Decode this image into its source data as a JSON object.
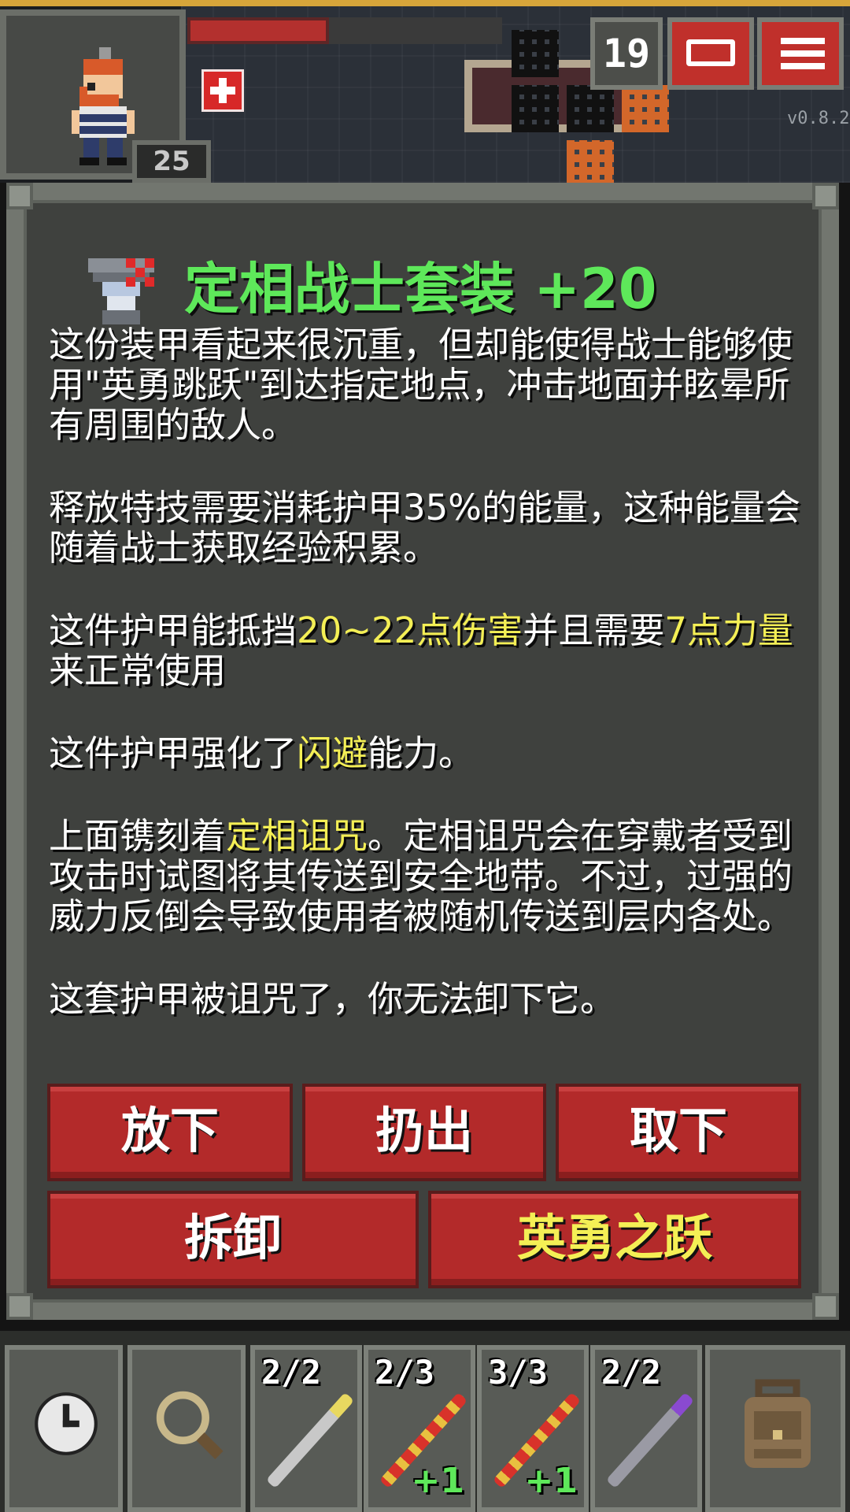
{
  "hud": {
    "depth": "19",
    "hero_level": "25",
    "version": "v0.8.2"
  },
  "dialog": {
    "title": "定相战士套装 +20",
    "item_icon": "warrior-armor-icon",
    "para1": "这份装甲看起来很沉重，但却能使得战士能够使用\"英勇跳跃\"到达指定地点，冲击地面并眩晕所有周围的敌人。",
    "para2": "释放特技需要消耗护甲35%的能量，这种能量会随着战士获取经验积累。",
    "para3_a": "这件护甲能抵挡",
    "para3_hl1": "20~22点伤害",
    "para3_b": "并且需要",
    "para3_hl2": "7点力量",
    "para3_c": "来正常使用",
    "para4_a": "这件护甲强化了",
    "para4_hl": "闪避",
    "para4_b": "能力。",
    "para5_a": "上面镌刻着",
    "para5_hl": "定相诅咒",
    "para5_b": "。定相诅咒会在穿戴者受到攻击时试图将其传送到安全地带。不过，过强的威力反倒会导致使用者被随机传送到层内各处。",
    "para6": "这套护甲被诅咒了，你无法卸下它。",
    "buttons": {
      "drop": "放下",
      "throw": "扔出",
      "unequip": "取下",
      "disassemble": "拆卸",
      "heroic_leap": "英勇之跃"
    }
  },
  "toolbar": {
    "slots": [
      {
        "charges": "2/2",
        "bonus": ""
      },
      {
        "charges": "2/3",
        "bonus": "+1"
      },
      {
        "charges": "3/3",
        "bonus": "+1"
      },
      {
        "charges": "2/2",
        "bonus": ""
      }
    ]
  },
  "colors": {
    "title_green": "#5ee85a",
    "highlight_yellow": "#f4ef55",
    "button_red": "#b32a2a",
    "panel_bg": "#3f413e"
  }
}
